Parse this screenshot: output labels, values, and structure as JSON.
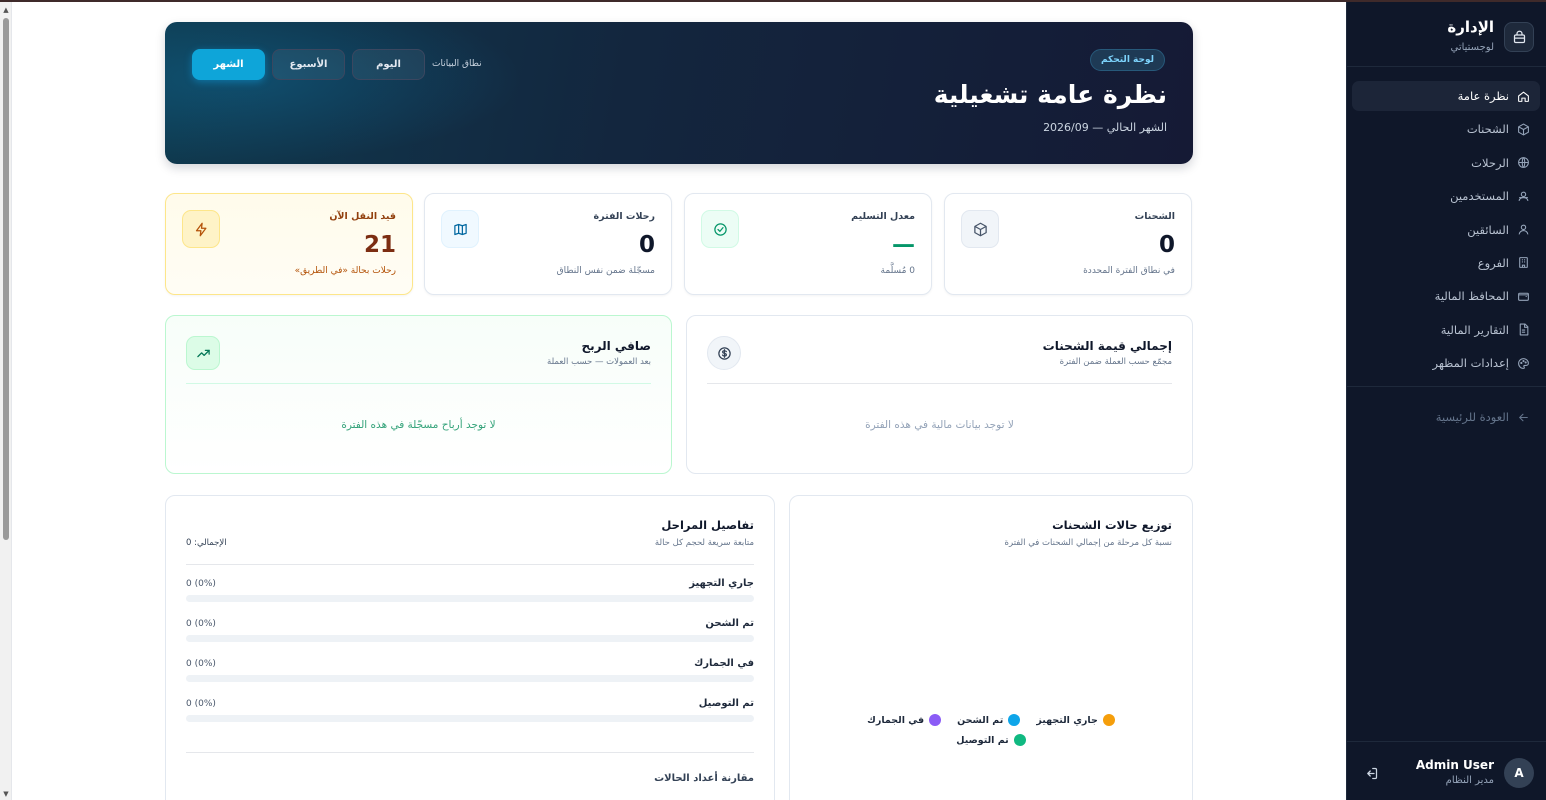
{
  "sidebar": {
    "brand_title": "الإدارة",
    "brand_subtitle": "لوجستياتي",
    "items": [
      {
        "label": "نظرة عامة",
        "icon": "home-icon",
        "active": true
      },
      {
        "label": "الشحنات",
        "icon": "package-icon",
        "active": false
      },
      {
        "label": "الرحلات",
        "icon": "globe-icon",
        "active": false
      },
      {
        "label": "المستخدمين",
        "icon": "users-icon",
        "active": false
      },
      {
        "label": "السائقين",
        "icon": "user-icon",
        "active": false
      },
      {
        "label": "الفروع",
        "icon": "building-icon",
        "active": false
      },
      {
        "label": "المحافظ المالية",
        "icon": "wallet-icon",
        "active": false
      },
      {
        "label": "التقارير المالية",
        "icon": "file-icon",
        "active": false
      },
      {
        "label": "إعدادات المظهر",
        "icon": "palette-icon",
        "active": false
      }
    ],
    "back_label": "العودة للرئيسية",
    "user": {
      "initial": "A",
      "name": "Admin User",
      "role": "مدير النظام"
    }
  },
  "hero": {
    "badge": "لوحة التحكم",
    "title": "نظرة عامة تشغيلية",
    "subtitle": "الشهر الحالي — 2026/09",
    "range_label": "نطاق البيانات",
    "ranges": [
      {
        "label": "اليوم",
        "active": false
      },
      {
        "label": "الأسبوع",
        "active": false
      },
      {
        "label": "الشهر",
        "active": true
      }
    ]
  },
  "stats": [
    {
      "label": "الشحنات",
      "value": "0",
      "note": "في نطاق الفترة المحددة",
      "icon": "box-icon"
    },
    {
      "label": "معدل التسليم",
      "value": "—",
      "note": "0 مُسلَّمة",
      "icon": "check-circle-icon"
    },
    {
      "label": "رحلات الفترة",
      "value": "0",
      "note": "مسجّلة ضمن نفس النطاق",
      "icon": "map-icon"
    },
    {
      "label": "قيد النقل الآن",
      "value": "21",
      "note": "رحلات بحالة «في الطريق»",
      "icon": "lightning-icon"
    }
  ],
  "finance": {
    "total": {
      "title": "إجمالي قيمة الشحنات",
      "subtitle": "مجمّع حسب العملة ضمن الفترة",
      "empty": "لا توجد بيانات مالية في هذه الفترة",
      "icon": "dollar-icon"
    },
    "profit": {
      "title": "صافي الربح",
      "subtitle": "بعد العمولات — حسب العملة",
      "empty": "لا توجد أرباح مسجّلة في هذه الفترة",
      "icon": "trending-up-icon"
    }
  },
  "distribution": {
    "title": "توزيع حالات الشحنات",
    "subtitle": "نسبة كل مرحلة من إجمالي الشحنات في الفترة",
    "legend": [
      {
        "label": "جاري التجهيز",
        "color": "#f59e0b"
      },
      {
        "label": "تم الشحن",
        "color": "#0ea5e9"
      },
      {
        "label": "في الجمارك",
        "color": "#8b5cf6"
      },
      {
        "label": "تم التوصيل",
        "color": "#10b981"
      }
    ]
  },
  "stages": {
    "title": "تفاصيل المراحل",
    "subtitle": "متابعة سريعة لحجم كل حالة",
    "total": "الإجمالي: 0",
    "items": [
      {
        "name": "جاري التجهيز",
        "value": "0 (0%)",
        "percent": 0
      },
      {
        "name": "تم الشحن",
        "value": "0 (0%)",
        "percent": 0
      },
      {
        "name": "في الجمارك",
        "value": "0 (0%)",
        "percent": 0
      },
      {
        "name": "تم التوصيل",
        "value": "0 (0%)",
        "percent": 0
      }
    ],
    "compare_title": "مقارنة أعداد الحالات"
  }
}
